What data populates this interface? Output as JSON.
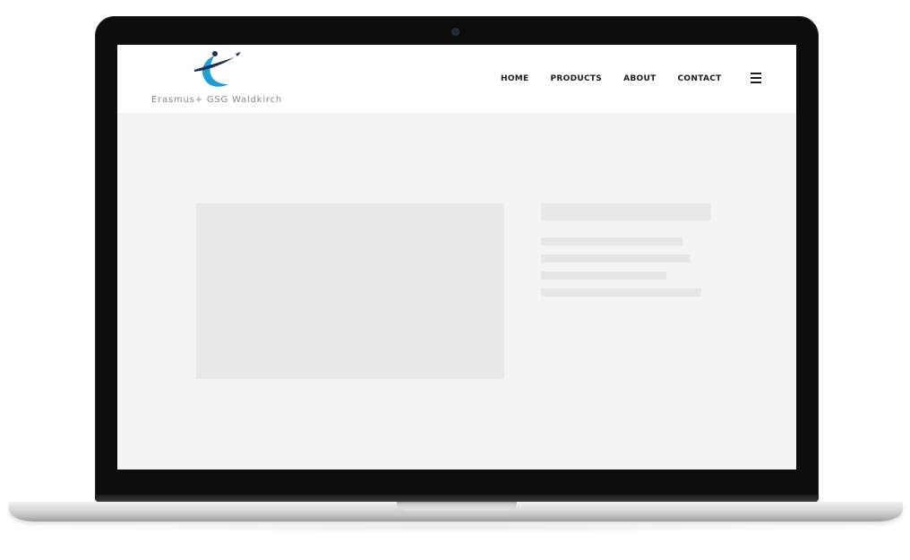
{
  "site": {
    "brand_text": "Erasmus+ GSG Waldkirch",
    "logo_icon": "erasmus-swoosh-logo",
    "nav": {
      "home": "HOME",
      "products": "PRODUCTS",
      "about": "ABOUT",
      "contact": "CONTACT"
    },
    "menu_icon": "hamburger-menu-icon"
  },
  "colors": {
    "logo_blue": "#1a9fd6",
    "logo_dark": "#1c2f5a",
    "placeholder": "#e8e8e8",
    "screen_bg": "#f4f4f4"
  }
}
